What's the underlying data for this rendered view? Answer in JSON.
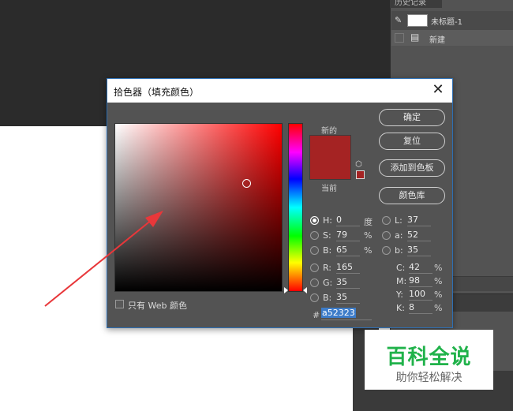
{
  "history_panel": {
    "tab_label": "历史记录",
    "snapshot_label": "未标题-1",
    "step_label": "新建"
  },
  "dialog": {
    "title": "拾色器（填充颜色）",
    "close_glyph": "✕",
    "new_label": "新的",
    "current_label": "当前",
    "new_color": "#a52323",
    "current_color": "#a52323",
    "buttons": {
      "ok": "确定",
      "reset": "复位",
      "add_to_swatches": "添加到色板",
      "color_libraries": "颜色库"
    },
    "web_only_label": "只有 Web 颜色",
    "fields": {
      "H": {
        "label": "H:",
        "value": "0",
        "unit": "度",
        "selected": true
      },
      "S": {
        "label": "S:",
        "value": "79",
        "unit": "%"
      },
      "B": {
        "label": "B:",
        "value": "65",
        "unit": "%"
      },
      "R": {
        "label": "R:",
        "value": "165"
      },
      "G": {
        "label": "G:",
        "value": "35"
      },
      "Bl": {
        "label": "B:",
        "value": "35"
      },
      "L": {
        "label": "L:",
        "value": "37"
      },
      "a": {
        "label": "a:",
        "value": "52"
      },
      "b": {
        "label": "b:",
        "value": "35"
      },
      "C": {
        "label": "C:",
        "value": "42",
        "unit": "%"
      },
      "M": {
        "label": "M:",
        "value": "98",
        "unit": "%"
      },
      "Y": {
        "label": "Y:",
        "value": "100",
        "unit": "%"
      },
      "K": {
        "label": "K:",
        "value": "8",
        "unit": "%"
      }
    },
    "hex_prefix": "#",
    "hex_value": "a52323",
    "cube_icon": "cube-icon"
  },
  "annotation": {
    "arrow_color": "#e8373a"
  },
  "watermark": {
    "title": "百科全说",
    "subtitle": "助你轻松解决",
    "title_color": "#20b24a"
  }
}
